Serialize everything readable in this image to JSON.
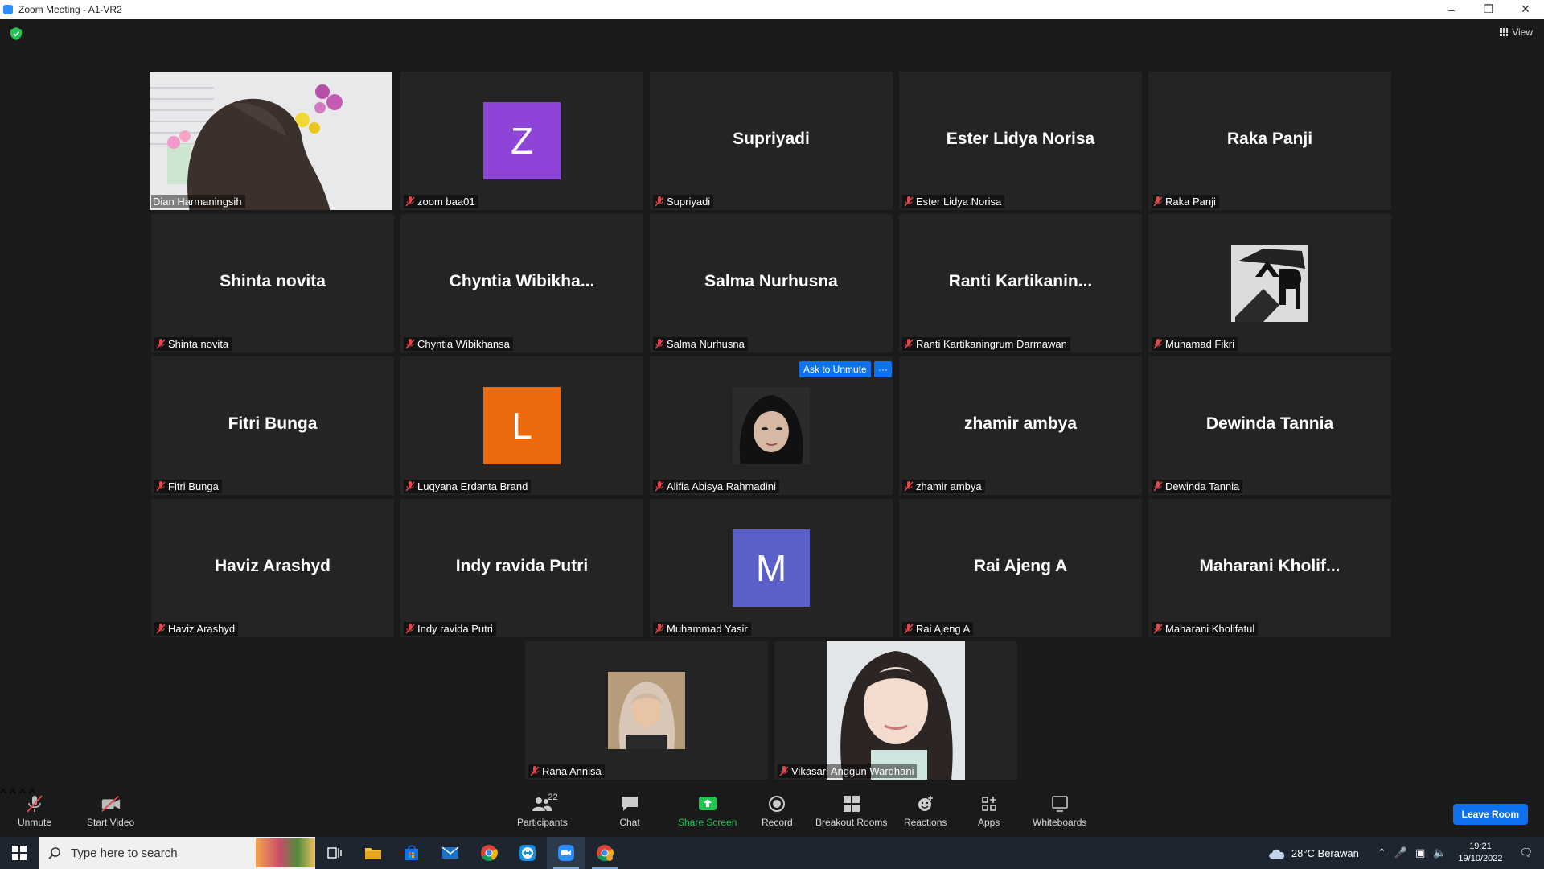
{
  "window": {
    "title": "Zoom Meeting - A1-VR2"
  },
  "view_label": "View",
  "tiles": [
    {
      "name": "Dian Harmaningsih"
    },
    {
      "name": "zoom baa01",
      "avatar_letter": "Z",
      "avatar_color": "#8e44d6"
    },
    {
      "name": "Supriyadi",
      "display": "Supriyadi"
    },
    {
      "name": "Ester Lidya Norisa",
      "display": "Ester Lidya Norisa"
    },
    {
      "name": "Raka Panji",
      "display": "Raka Panji"
    },
    {
      "name": "Shinta novita",
      "display": "Shinta novita"
    },
    {
      "name": "Chyntia Wibikhansa",
      "display": "Chyntia  Wibikha..."
    },
    {
      "name": "Salma Nurhusna",
      "display": "Salma Nurhusna"
    },
    {
      "name": "Ranti Kartikaningrum Darmawan",
      "display": "Ranti  Kartikanin..."
    },
    {
      "name": "Muhamad Fikri"
    },
    {
      "name": "Fitri Bunga",
      "display": "Fitri Bunga"
    },
    {
      "name": "Luqyana Erdanta Brand",
      "avatar_letter": "L",
      "avatar_color": "#ec6a0b"
    },
    {
      "name": "Alifia Abisya Rahmadini"
    },
    {
      "name": "zhamir ambya",
      "display": "zhamir ambya"
    },
    {
      "name": "Dewinda Tannia",
      "display": "Dewinda Tannia"
    },
    {
      "name": "Haviz Arashyd",
      "display": "Haviz Arashyd"
    },
    {
      "name": "Indy ravida Putri",
      "display": "Indy ravida Putri"
    },
    {
      "name": "Muhammad Yasir",
      "avatar_letter": "M",
      "avatar_color": "#5a5fc9"
    },
    {
      "name": "Rai Ajeng A",
      "display": "Rai Ajeng A"
    },
    {
      "name": "Maharani Kholifatul",
      "display": "Maharani  Kholif..."
    },
    {
      "name": "Rana Annisa"
    },
    {
      "name": "Vikasari Anggun Wardhani"
    }
  ],
  "hover_actions": {
    "ask_to_unmute": "Ask to Unmute",
    "more": "···"
  },
  "toolbar": {
    "unmute": "Unmute",
    "start_video": "Start Video",
    "participants": "Participants",
    "participants_count": "22",
    "chat": "Chat",
    "share_screen": "Share Screen",
    "record": "Record",
    "breakout_rooms": "Breakout Rooms",
    "reactions": "Reactions",
    "apps": "Apps",
    "whiteboards": "Whiteboards",
    "leave_room": "Leave Room"
  },
  "taskbar": {
    "search_placeholder": "Type here to search",
    "weather": "28°C  Berawan",
    "time": "19:21",
    "date": "19/10/2022"
  },
  "colors": {
    "accent": "#0e72ed",
    "active_speaker": "#e8f26b",
    "share_green": "#23c552"
  }
}
